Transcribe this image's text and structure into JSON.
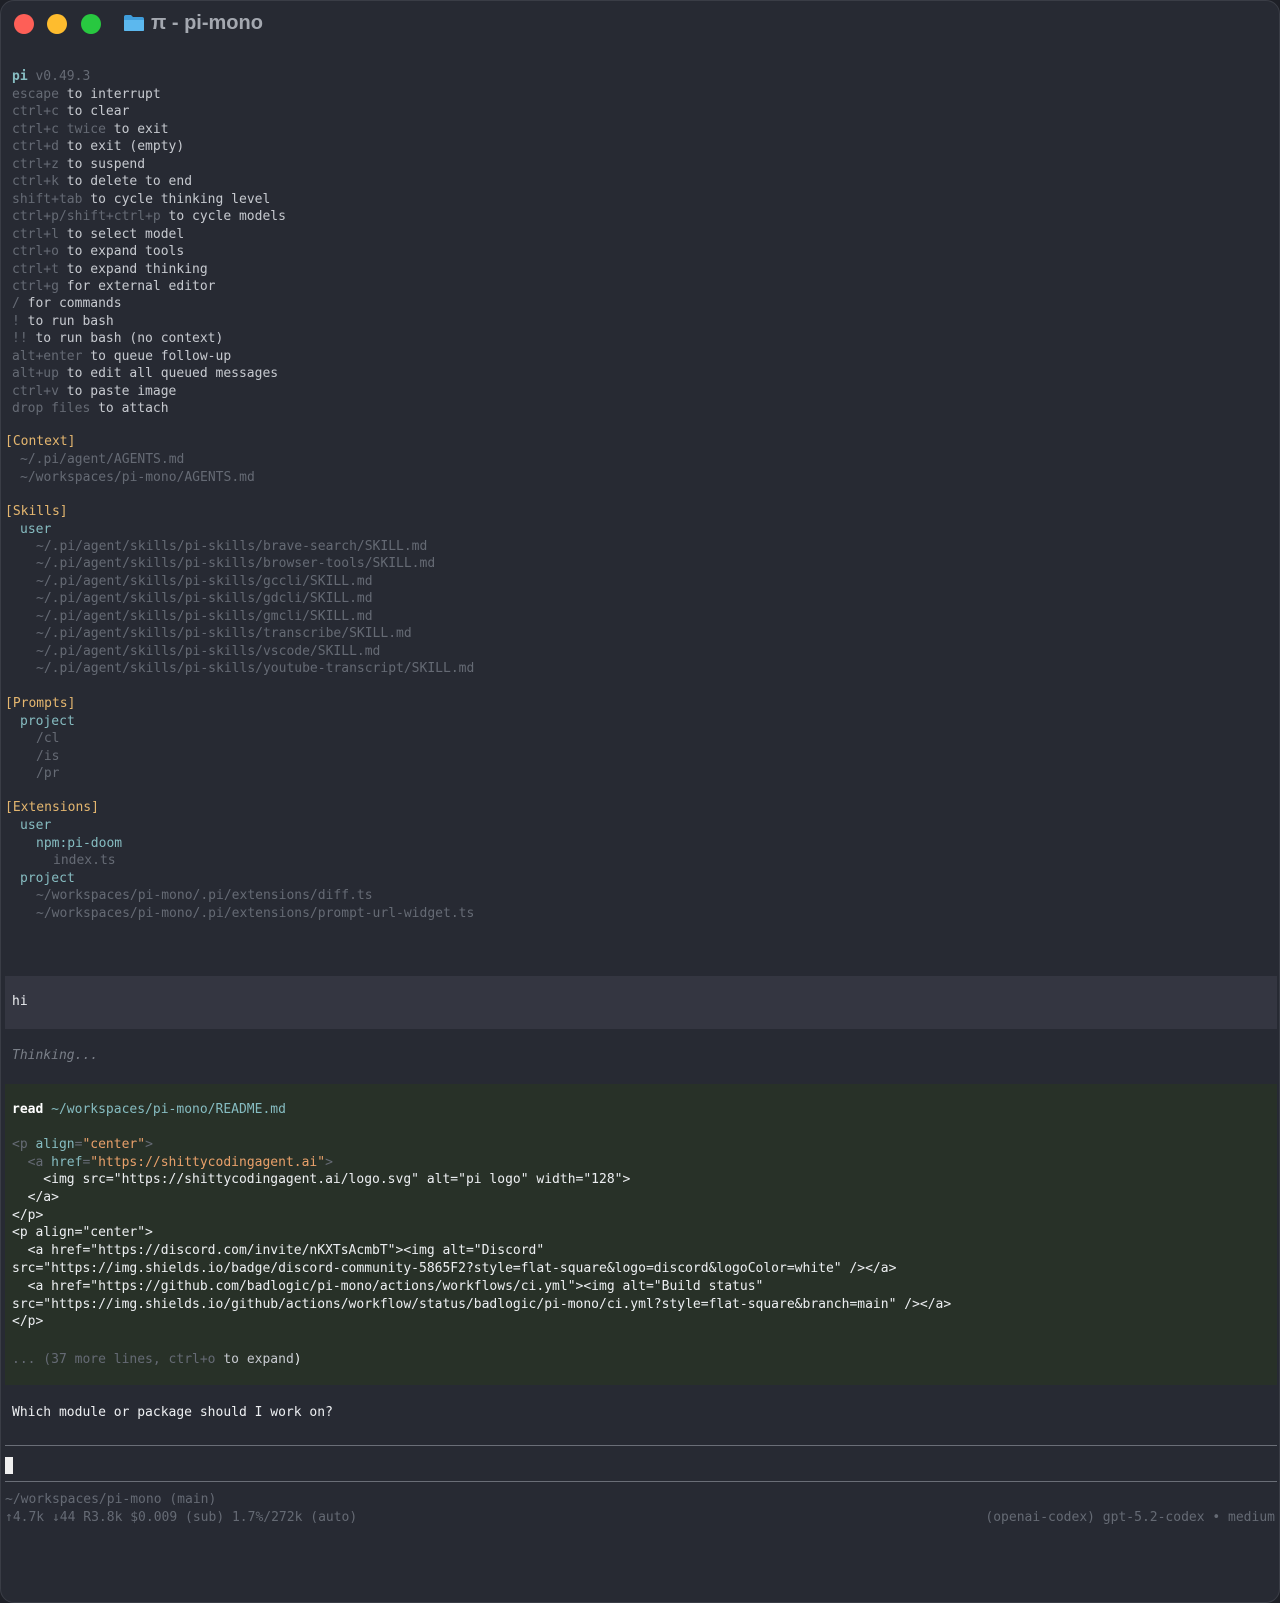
{
  "window": {
    "title": "π - pi-mono",
    "folder_icon": "folder-icon",
    "accent": "#4aa8e0"
  },
  "header": {
    "app": "pi",
    "version": "v0.49.3",
    "shortcuts": [
      {
        "key": "escape",
        "desc": "to interrupt"
      },
      {
        "key": "ctrl+c",
        "desc": "to clear"
      },
      {
        "key": "ctrl+c twice",
        "desc": "to exit"
      },
      {
        "key": "ctrl+d",
        "desc": "to exit (empty)"
      },
      {
        "key": "ctrl+z",
        "desc": "to suspend"
      },
      {
        "key": "ctrl+k",
        "desc": "to delete to end"
      },
      {
        "key": "shift+tab",
        "desc": "to cycle thinking level"
      },
      {
        "key": "ctrl+p/shift+ctrl+p",
        "desc": "to cycle models"
      },
      {
        "key": "ctrl+l",
        "desc": "to select model"
      },
      {
        "key": "ctrl+o",
        "desc": "to expand tools"
      },
      {
        "key": "ctrl+t",
        "desc": "to expand thinking"
      },
      {
        "key": "ctrl+g",
        "desc": "for external editor"
      },
      {
        "key": "/",
        "desc": "for commands"
      },
      {
        "key": "!",
        "desc": "to run bash"
      },
      {
        "key": "!!",
        "desc": "to run bash (no context)"
      },
      {
        "key": "alt+enter",
        "desc": "to queue follow-up"
      },
      {
        "key": "alt+up",
        "desc": "to edit all queued messages"
      },
      {
        "key": "ctrl+v",
        "desc": "to paste image"
      },
      {
        "key": "drop files",
        "desc": "to attach"
      }
    ]
  },
  "context": {
    "heading": "[Context]",
    "files": [
      "~/.pi/agent/AGENTS.md",
      "~/workspaces/pi-mono/AGENTS.md"
    ]
  },
  "skills": {
    "heading": "[Skills]",
    "group": "user",
    "files": [
      "~/.pi/agent/skills/pi-skills/brave-search/SKILL.md",
      "~/.pi/agent/skills/pi-skills/browser-tools/SKILL.md",
      "~/.pi/agent/skills/pi-skills/gccli/SKILL.md",
      "~/.pi/agent/skills/pi-skills/gdcli/SKILL.md",
      "~/.pi/agent/skills/pi-skills/gmcli/SKILL.md",
      "~/.pi/agent/skills/pi-skills/transcribe/SKILL.md",
      "~/.pi/agent/skills/pi-skills/vscode/SKILL.md",
      "~/.pi/agent/skills/pi-skills/youtube-transcript/SKILL.md"
    ]
  },
  "prompts": {
    "heading": "[Prompts]",
    "group": "project",
    "items": [
      "/cl",
      "/is",
      "/pr"
    ]
  },
  "extensions": {
    "heading": "[Extensions]",
    "user_group": "user",
    "user_pkg": "npm:pi-doom",
    "user_pkg_file": "index.ts",
    "project_group": "project",
    "project_files": [
      "~/workspaces/pi-mono/.pi/extensions/diff.ts",
      "~/workspaces/pi-mono/.pi/extensions/prompt-url-widget.ts"
    ]
  },
  "conversation": {
    "user_message": "hi",
    "thinking": "Thinking...",
    "tool": {
      "name": "read",
      "path": "~/workspaces/pi-mono/README.md",
      "l1_open": "<p ",
      "l1_attr": "align",
      "l1_eq": "=",
      "l1_val": "\"center\"",
      "l1_close": ">",
      "l2_open": "  <a ",
      "l2_attr": "href",
      "l2_eq": "=",
      "l2_val": "\"https://shittycodingagent.ai\"",
      "l2_close": ">",
      "lines": [
        "    <img src=\"https://shittycodingagent.ai/logo.svg\" alt=\"pi logo\" width=\"128\">",
        "  </a>",
        "</p>",
        "<p align=\"center\">",
        "  <a href=\"https://discord.com/invite/nKXTsAcmbT\"><img alt=\"Discord\"",
        "src=\"https://img.shields.io/badge/discord-community-5865F2?style=flat-square&logo=discord&logoColor=white\" /></a>",
        "  <a href=\"https://github.com/badlogic/pi-mono/actions/workflows/ci.yml\"><img alt=\"Build status\"",
        "src=\"https://img.shields.io/github/actions/workflow/status/badlogic/pi-mono/ci.yml?style=flat-square&branch=main\" /></a>",
        "</p>"
      ],
      "more_prefix": "... (37 more lines, ",
      "more_key": "ctrl+o",
      "more_suffix": " to expand",
      "more_paren": ")"
    },
    "assistant_reply": "Which module or package should I work on?"
  },
  "status": {
    "cwd": "~/workspaces/pi-mono (main)",
    "usage": "↑4.7k ↓44 R3.8k $0.009 (sub) 1.7%/272k (auto)",
    "model": "(openai-codex) gpt-5.2-codex • medium"
  }
}
